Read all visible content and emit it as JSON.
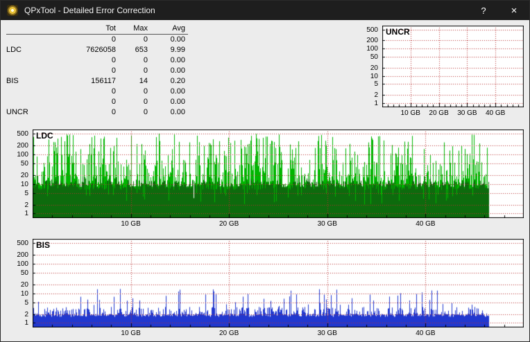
{
  "window": {
    "title": "QPxTool - Detailed Error Correction",
    "help_label": "?",
    "close_label": "×"
  },
  "stats_table": {
    "columns": [
      "Tot",
      "Max",
      "Avg"
    ],
    "rows": [
      {
        "label": "",
        "tot": "0",
        "max": "0",
        "avg": "0.00"
      },
      {
        "label": "LDC",
        "tot": "7626058",
        "max": "653",
        "avg": "9.99"
      },
      {
        "label": "",
        "tot": "0",
        "max": "0",
        "avg": "0.00"
      },
      {
        "label": "",
        "tot": "0",
        "max": "0",
        "avg": "0.00"
      },
      {
        "label": "BIS",
        "tot": "156117",
        "max": "14",
        "avg": "0.20"
      },
      {
        "label": "",
        "tot": "0",
        "max": "0",
        "avg": "0.00"
      },
      {
        "label": "",
        "tot": "0",
        "max": "0",
        "avg": "0.00"
      },
      {
        "label": "UNCR",
        "tot": "0",
        "max": "0",
        "avg": "0.00"
      }
    ]
  },
  "chart_data": [
    {
      "id": "uncr",
      "type": "area",
      "title": "UNCR",
      "y_scale": "log",
      "y_ticks": [
        1,
        2,
        5,
        10,
        20,
        50,
        100,
        200,
        500
      ],
      "x_ticks": [
        "10 GB",
        "20 GB",
        "30 GB",
        "40 GB"
      ],
      "x_range_gb": [
        0,
        50
      ],
      "data_end_gb": 46.5,
      "grid_color": "#b83030",
      "seed": 1,
      "summary": {
        "tot": 0,
        "max": 0,
        "avg": 0.0
      },
      "series": []
    },
    {
      "id": "ldc",
      "type": "area",
      "title": "LDC",
      "y_scale": "log",
      "y_ticks": [
        1,
        2,
        5,
        10,
        20,
        50,
        100,
        200,
        500
      ],
      "x_ticks": [
        "10 GB",
        "20 GB",
        "30 GB",
        "40 GB"
      ],
      "x_range_gb": [
        0,
        50
      ],
      "data_end_gb": 46.5,
      "grid_color": "#b83030",
      "seed": 7,
      "summary": {
        "tot": 7626058,
        "max": 653,
        "avg": 9.99
      },
      "series": [
        {
          "name": "ldc-peaks",
          "color": "#00b600",
          "gen": {
            "exp_base": 0.9,
            "exp_span": 1.8,
            "exp_pow": 2.6,
            "dip_chance": 0.05,
            "dip_lo": 1,
            "dip_hi": 4,
            "hotspots": [
              {
                "from": 0.3,
                "to": 2.3,
                "pow_mult": 0.8
              },
              {
                "from": 21.3,
                "to": 25.2,
                "pow_mult": 0.45
              },
              {
                "from": 35.7,
                "to": 38.3,
                "pow_mult": 0.7
              }
            ]
          }
        },
        {
          "name": "ldc-average-band",
          "color": "#0d6b0d",
          "gen": {
            "exp_base": 0.8,
            "exp_span": 0.32,
            "exp_pow": 1,
            "spike_chance": 0.12,
            "spike_base": 1.0,
            "spike_span": 0.28,
            "dip_chance": 0.07,
            "dip_lo": 2,
            "dip_hi": 5
          }
        }
      ]
    },
    {
      "id": "bis",
      "type": "area",
      "title": "BIS",
      "y_scale": "log",
      "y_ticks": [
        1,
        2,
        5,
        10,
        20,
        50,
        100,
        200,
        500
      ],
      "x_ticks": [
        "10 GB",
        "20 GB",
        "30 GB",
        "40 GB"
      ],
      "x_range_gb": [
        0,
        50
      ],
      "data_end_gb": 46.5,
      "grid_color": "#b83030",
      "seed": 13,
      "summary": {
        "tot": 156117,
        "max": 14,
        "avg": 0.2
      },
      "series": [
        {
          "name": "bis-errors",
          "color": "#2138cf",
          "gen": {
            "exp_base": 0.12,
            "exp_span": 0.42,
            "exp_pow": 1.7,
            "spike_chance": 0.09,
            "spike_base": 0.5,
            "spike_span": 0.68,
            "floor_lo": 1.6,
            "floor_hi": 2.0,
            "hotspots": [
              {
                "from": 21,
                "to": 26,
                "pow_mult": 0.55
              }
            ]
          }
        }
      ]
    }
  ]
}
